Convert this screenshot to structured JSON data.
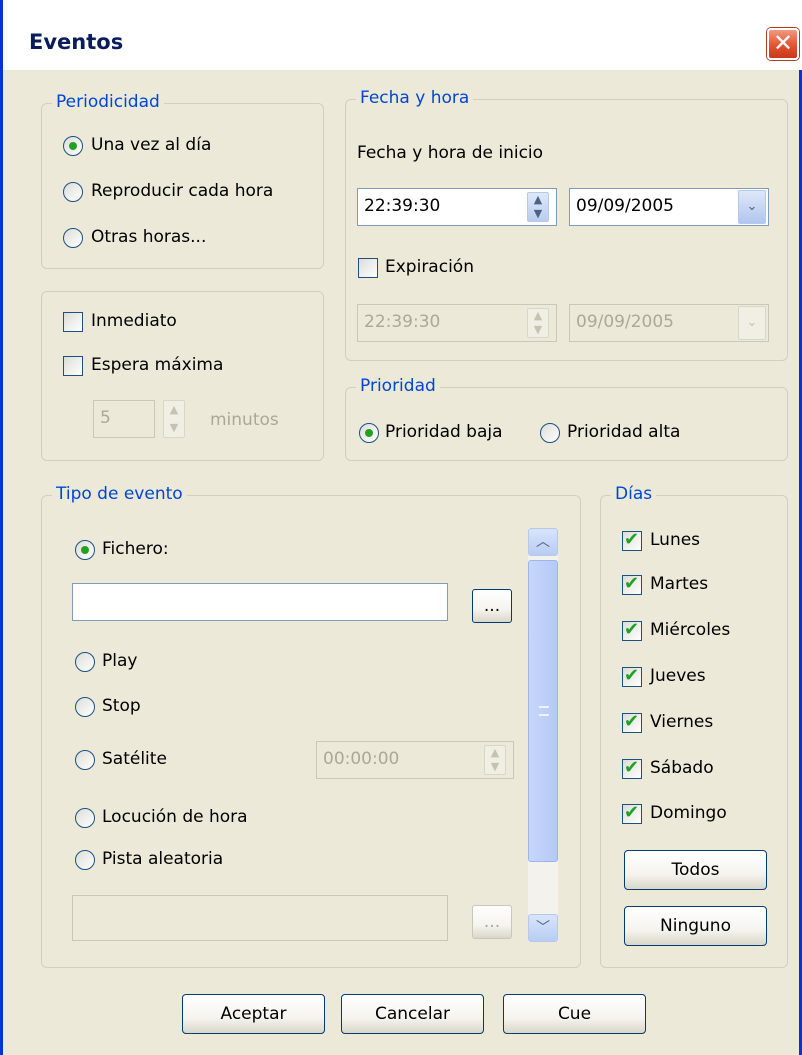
{
  "window": {
    "title": "Eventos",
    "close_icon": "✕"
  },
  "periodicidad": {
    "legend": "Periodicidad",
    "options": [
      "Una vez al día",
      "Reproducir cada hora",
      "Otras horas..."
    ],
    "selected": "Una vez al día"
  },
  "espera": {
    "inmediato_label": "Inmediato",
    "espera_maxima_label": "Espera máxima",
    "minutes_value": "5",
    "minutes_label": "minutos"
  },
  "fecha_hora": {
    "legend": "Fecha y hora",
    "start_label": "Fecha y hora de inicio",
    "start_time": "22:39:30",
    "start_date": "09/09/2005",
    "expiracion_label": "Expiración",
    "exp_time": "22:39:30",
    "exp_date": "09/09/2005"
  },
  "prioridad": {
    "legend": "Prioridad",
    "options": [
      "Prioridad baja",
      "Prioridad alta"
    ],
    "selected": "Prioridad baja"
  },
  "tipo_evento": {
    "legend": "Tipo de evento",
    "fichero_label": "Fichero:",
    "fichero_value": "",
    "browse_label": "...",
    "play_label": "Play",
    "stop_label": "Stop",
    "satelite_label": "Satélite",
    "satelite_time": "00:00:00",
    "locucion_label": "Locución de hora",
    "pista_label": "Pista aleatoria",
    "pista_value": "",
    "pista_browse_label": "...",
    "selected": "Fichero:"
  },
  "dias": {
    "legend": "Días",
    "days": [
      "Lunes",
      "Martes",
      "Miércoles",
      "Jueves",
      "Viernes",
      "Sábado",
      "Domingo"
    ],
    "todos_label": "Todos",
    "ninguno_label": "Ninguno"
  },
  "footer": {
    "aceptar_label": "Aceptar",
    "cancelar_label": "Cancelar",
    "cue_label": "Cue"
  },
  "icons": {
    "spin_up": "▲",
    "spin_down": "▼",
    "combo_down": "⌄",
    "scroll_up": "︿",
    "scroll_down": "﹀"
  },
  "colors": {
    "window_bg": "#ece9d8",
    "legend_text": "#0046d5",
    "check_green": "#21a121",
    "frame_blue": "#0831d9",
    "close_red": "#e2532f"
  }
}
